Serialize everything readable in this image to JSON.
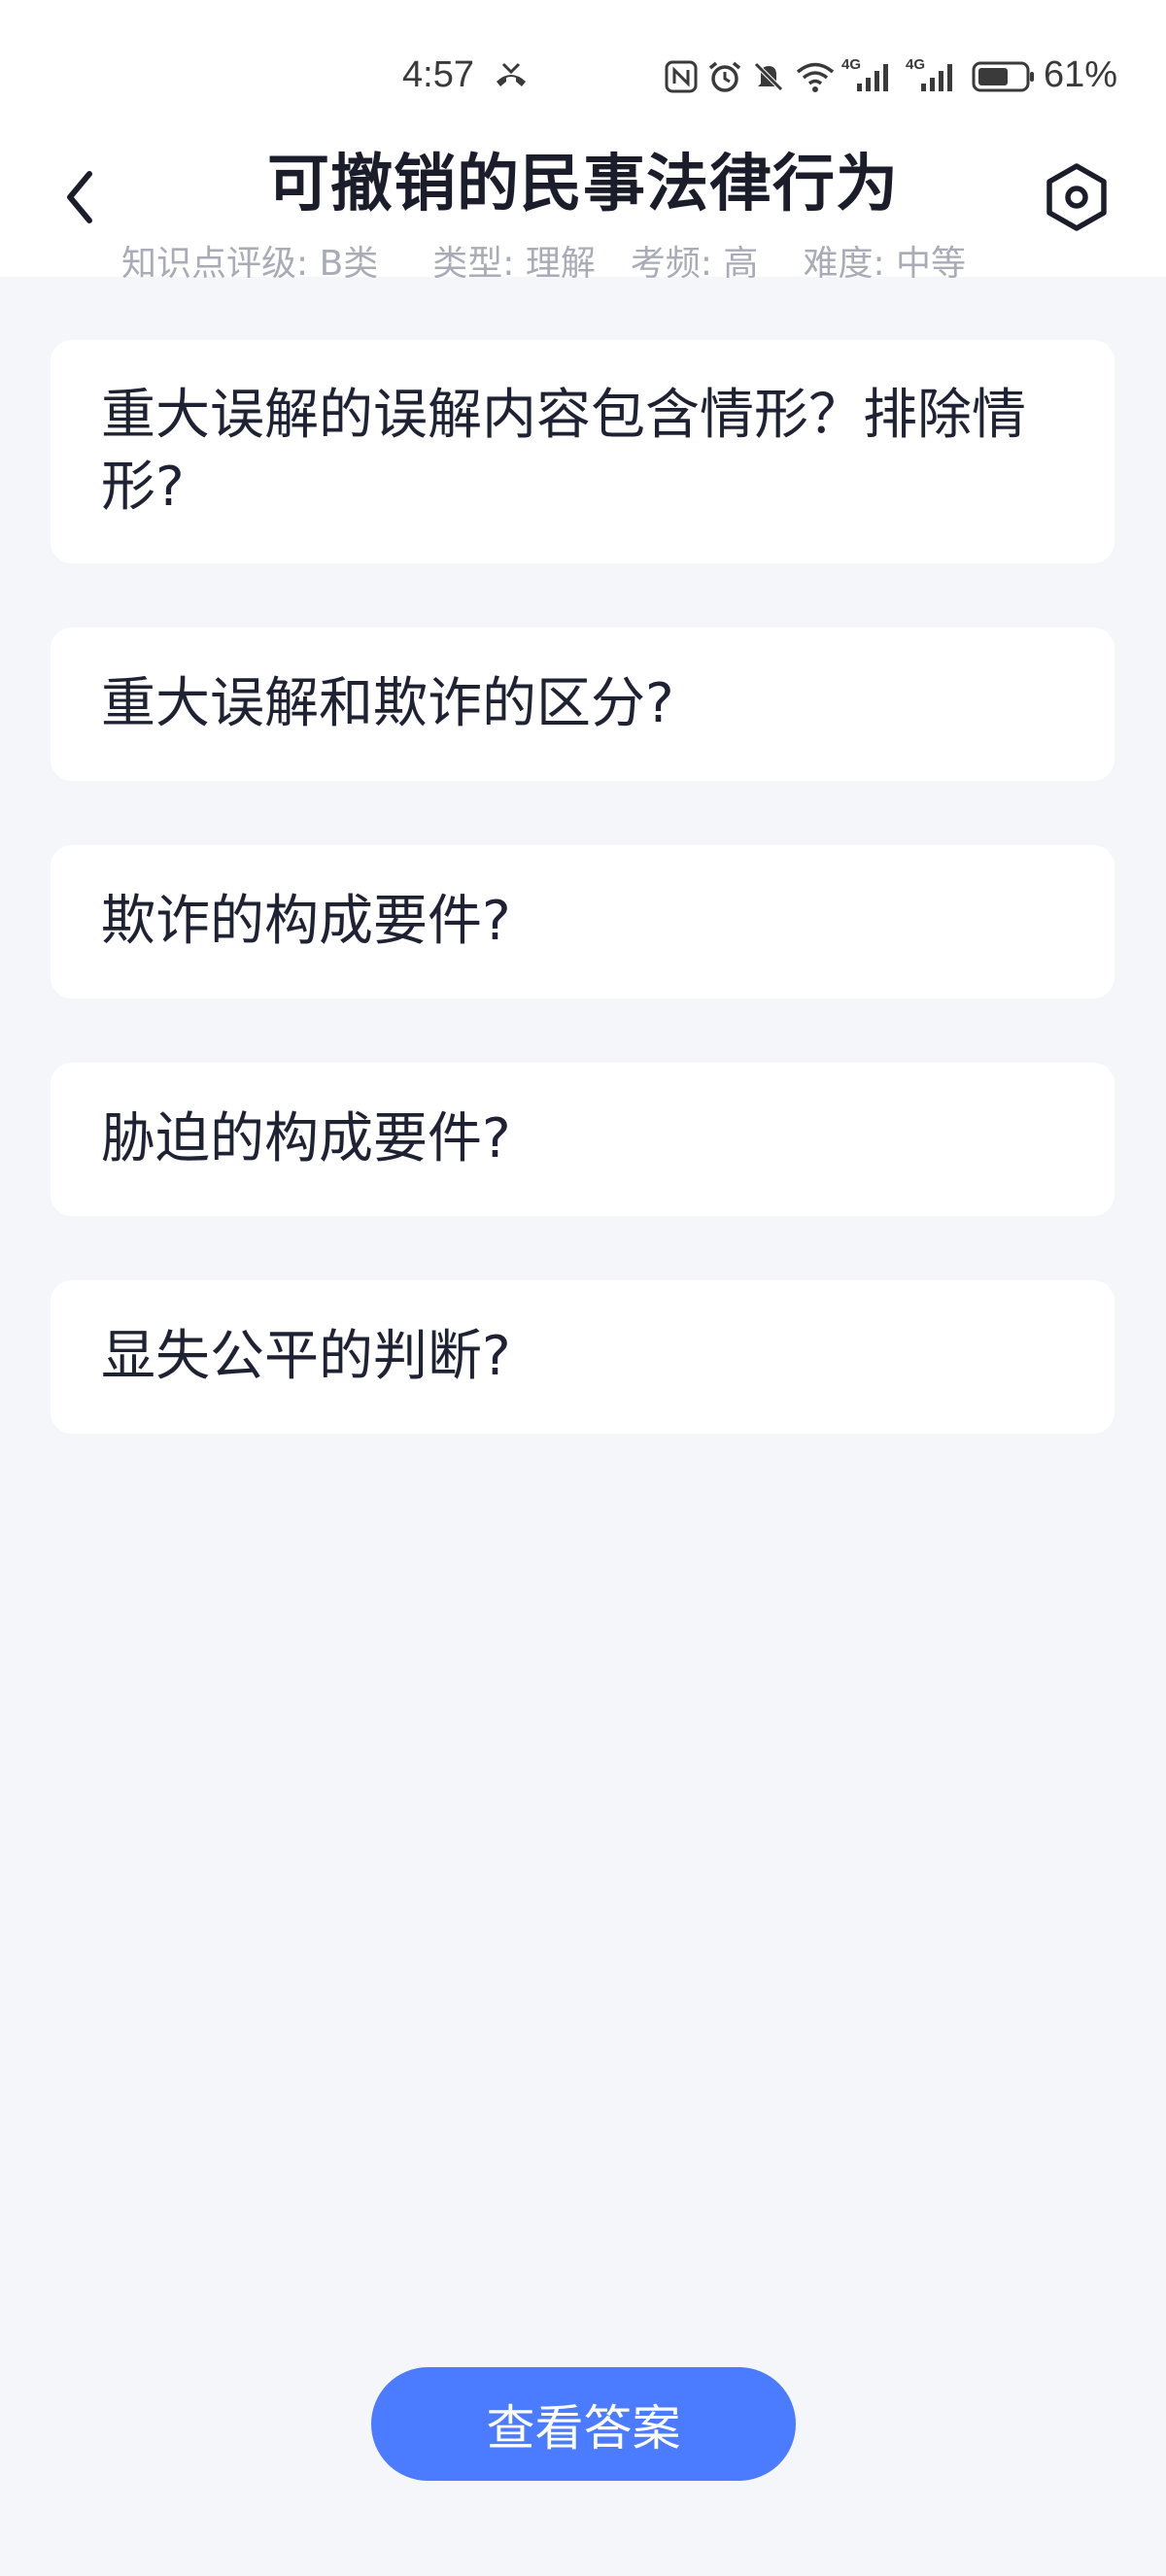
{
  "status_bar": {
    "time": "4:57",
    "battery_percent": "61%",
    "network_label_1": "4G",
    "network_label_2": "4G",
    "icons": [
      "missed-call-icon",
      "nfc-icon",
      "alarm-icon",
      "mute-bell-icon",
      "wifi-icon",
      "signal-4g-icon",
      "signal-4g-icon",
      "battery-icon"
    ]
  },
  "header": {
    "title": "可撤销的民事法律行为",
    "back_icon": "chevron-left-icon",
    "settings_icon": "hexagon-settings-icon",
    "meta": {
      "level": "知识点评级: B类",
      "type": "类型: 理解",
      "frequency": "考频: 高",
      "difficulty": "难度: 中等"
    }
  },
  "questions": [
    "重大误解的误解内容包含情形？排除情形?",
    "重大误解和欺诈的区分?",
    "欺诈的构成要件?",
    "胁迫的构成要件?",
    "显失公平的判断?"
  ],
  "footer": {
    "answer_button_label": "查看答案"
  },
  "colors": {
    "background": "#f5f6fa",
    "card": "#ffffff",
    "accent": "#4b7bff",
    "title": "#1b1d2b",
    "meta_text": "#a9acb7"
  }
}
